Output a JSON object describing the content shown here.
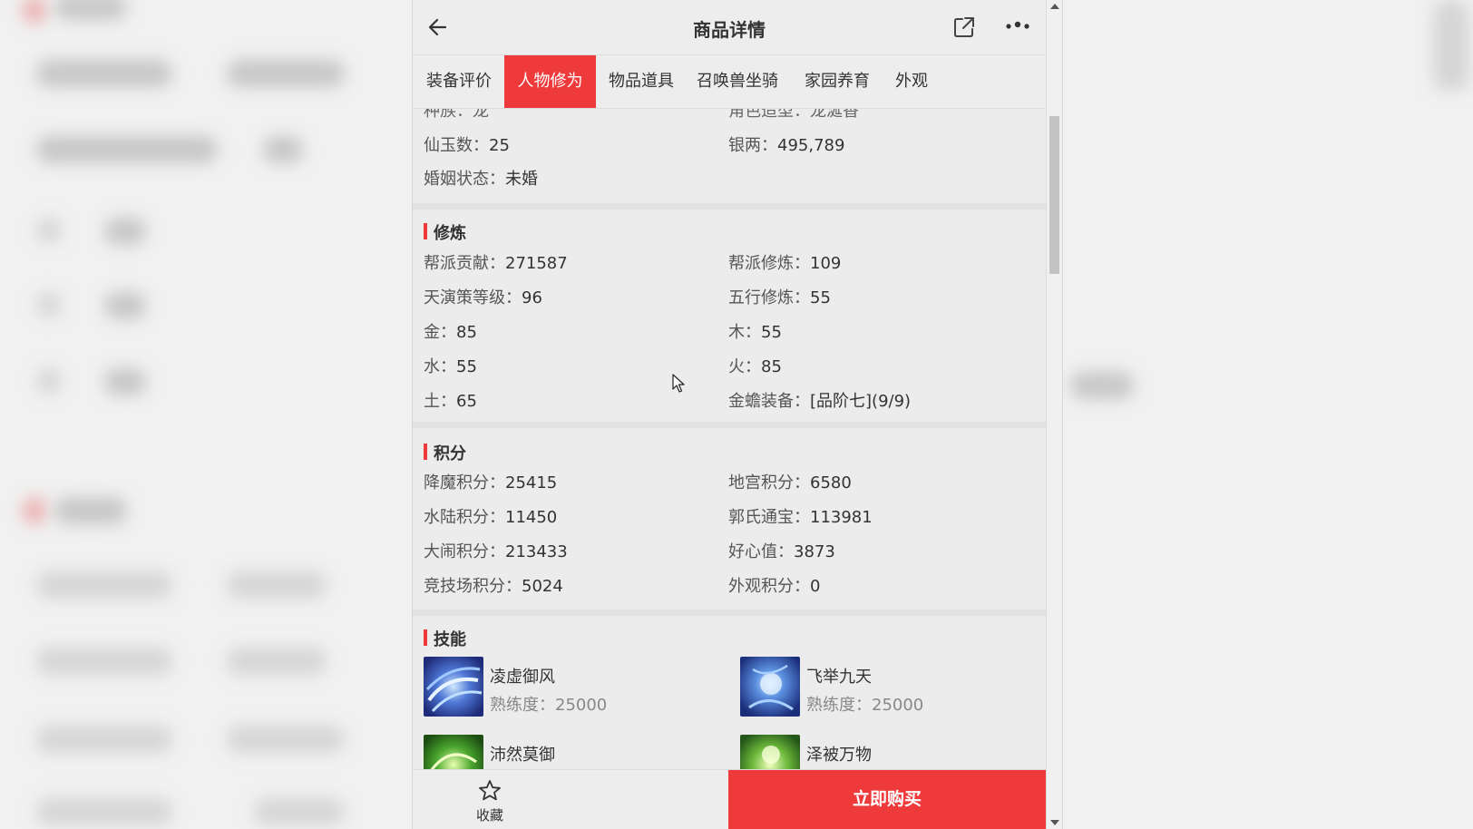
{
  "header": {
    "title": "商品详情"
  },
  "tabs": [
    {
      "label": "装备评价"
    },
    {
      "label": "人物修为",
      "active": true
    },
    {
      "label": "物品道具"
    },
    {
      "label": "召唤兽坐骑"
    },
    {
      "label": "家园养育"
    },
    {
      "label": "外观"
    }
  ],
  "basic": {
    "partial_left": "种族：龙",
    "partial_right": "角色造型：龙涎香",
    "items": [
      {
        "key": "仙玉数：",
        "value": "25"
      },
      {
        "key": "银两：",
        "value": "495,789"
      },
      {
        "key": "婚姻状态：",
        "value": "未婚"
      }
    ]
  },
  "cultivation": {
    "title": "修炼",
    "items": [
      {
        "key": "帮派贡献：",
        "value": "271587"
      },
      {
        "key": "帮派修炼：",
        "value": "109"
      },
      {
        "key": "天演策等级：",
        "value": "96"
      },
      {
        "key": "五行修炼：",
        "value": "55"
      },
      {
        "key": "金：",
        "value": "85"
      },
      {
        "key": "木：",
        "value": "55"
      },
      {
        "key": "水：",
        "value": "55"
      },
      {
        "key": "火：",
        "value": "85"
      },
      {
        "key": "土：",
        "value": "65"
      },
      {
        "key": "金蟾装备：",
        "value": "[品阶七](9/9)"
      }
    ]
  },
  "points": {
    "title": "积分",
    "items": [
      {
        "key": "降魔积分：",
        "value": "25415"
      },
      {
        "key": "地宫积分：",
        "value": "6580"
      },
      {
        "key": "水陆积分：",
        "value": "11450"
      },
      {
        "key": "郭氏通宝：",
        "value": "113981"
      },
      {
        "key": "大闹积分：",
        "value": "213433"
      },
      {
        "key": "好心值：",
        "value": "3873"
      },
      {
        "key": "竞技场积分：",
        "value": "5024"
      },
      {
        "key": "外观积分：",
        "value": "0"
      }
    ]
  },
  "skills": {
    "title": "技能",
    "prof_label": "熟练度：",
    "items": [
      {
        "name": "凌虚御风",
        "proficiency": "25000",
        "icon": "wind-skill-icon"
      },
      {
        "name": "飞举九天",
        "proficiency": "25000",
        "icon": "flight-skill-icon"
      },
      {
        "name": "沛然莫御",
        "proficiency": "",
        "icon": "nature-skill-icon"
      },
      {
        "name": "泽被万物",
        "proficiency": "",
        "icon": "blessing-skill-icon"
      }
    ]
  },
  "bottom": {
    "favorite_label": "收藏",
    "buy_label": "立即购买"
  },
  "colors": {
    "accent": "#ee3a3a"
  }
}
